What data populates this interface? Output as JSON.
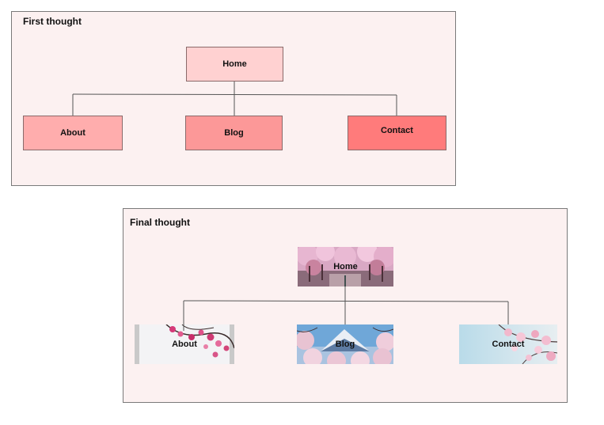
{
  "diagrams": {
    "first": {
      "title": "First thought",
      "root": {
        "label": "Home",
        "color": "#ffd1d1"
      },
      "children": [
        {
          "label": "About",
          "color": "#ffadad"
        },
        {
          "label": "Blog",
          "color": "#fc9898"
        },
        {
          "label": "Contact",
          "color": "#ff7b7b"
        }
      ]
    },
    "final": {
      "title": "Final thought",
      "root": {
        "label": "Home",
        "image": "cherry-blossom-avenue-photo"
      },
      "children": [
        {
          "label": "About",
          "image": "pink-blossom-branch-photo"
        },
        {
          "label": "Blog",
          "image": "mount-fuji-blossom-photo"
        },
        {
          "label": "Contact",
          "image": "pale-blossom-sky-photo"
        }
      ]
    }
  },
  "colors": {
    "frame_background": "#fcf1f1",
    "frame_border": "#7a7a7a",
    "connector": "#555555"
  }
}
